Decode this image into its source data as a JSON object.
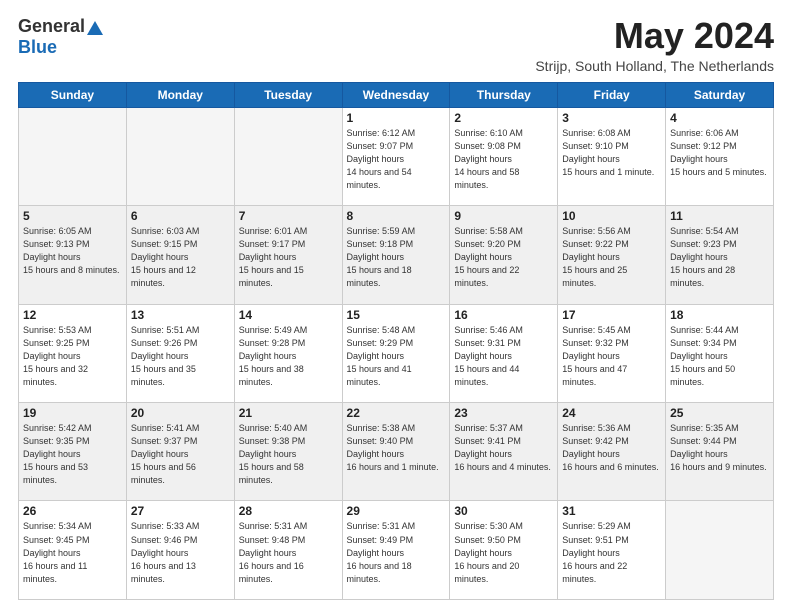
{
  "header": {
    "logo_general": "General",
    "logo_blue": "Blue",
    "month_title": "May 2024",
    "location": "Strijp, South Holland, The Netherlands"
  },
  "days_of_week": [
    "Sunday",
    "Monday",
    "Tuesday",
    "Wednesday",
    "Thursday",
    "Friday",
    "Saturday"
  ],
  "weeks": [
    [
      {
        "day": "",
        "empty": true
      },
      {
        "day": "",
        "empty": true
      },
      {
        "day": "",
        "empty": true
      },
      {
        "day": "1",
        "sunrise": "6:12 AM",
        "sunset": "9:07 PM",
        "daylight": "14 hours and 54 minutes."
      },
      {
        "day": "2",
        "sunrise": "6:10 AM",
        "sunset": "9:08 PM",
        "daylight": "14 hours and 58 minutes."
      },
      {
        "day": "3",
        "sunrise": "6:08 AM",
        "sunset": "9:10 PM",
        "daylight": "15 hours and 1 minute."
      },
      {
        "day": "4",
        "sunrise": "6:06 AM",
        "sunset": "9:12 PM",
        "daylight": "15 hours and 5 minutes."
      }
    ],
    [
      {
        "day": "5",
        "sunrise": "6:05 AM",
        "sunset": "9:13 PM",
        "daylight": "15 hours and 8 minutes."
      },
      {
        "day": "6",
        "sunrise": "6:03 AM",
        "sunset": "9:15 PM",
        "daylight": "15 hours and 12 minutes."
      },
      {
        "day": "7",
        "sunrise": "6:01 AM",
        "sunset": "9:17 PM",
        "daylight": "15 hours and 15 minutes."
      },
      {
        "day": "8",
        "sunrise": "5:59 AM",
        "sunset": "9:18 PM",
        "daylight": "15 hours and 18 minutes."
      },
      {
        "day": "9",
        "sunrise": "5:58 AM",
        "sunset": "9:20 PM",
        "daylight": "15 hours and 22 minutes."
      },
      {
        "day": "10",
        "sunrise": "5:56 AM",
        "sunset": "9:22 PM",
        "daylight": "15 hours and 25 minutes."
      },
      {
        "day": "11",
        "sunrise": "5:54 AM",
        "sunset": "9:23 PM",
        "daylight": "15 hours and 28 minutes."
      }
    ],
    [
      {
        "day": "12",
        "sunrise": "5:53 AM",
        "sunset": "9:25 PM",
        "daylight": "15 hours and 32 minutes."
      },
      {
        "day": "13",
        "sunrise": "5:51 AM",
        "sunset": "9:26 PM",
        "daylight": "15 hours and 35 minutes."
      },
      {
        "day": "14",
        "sunrise": "5:49 AM",
        "sunset": "9:28 PM",
        "daylight": "15 hours and 38 minutes."
      },
      {
        "day": "15",
        "sunrise": "5:48 AM",
        "sunset": "9:29 PM",
        "daylight": "15 hours and 41 minutes."
      },
      {
        "day": "16",
        "sunrise": "5:46 AM",
        "sunset": "9:31 PM",
        "daylight": "15 hours and 44 minutes."
      },
      {
        "day": "17",
        "sunrise": "5:45 AM",
        "sunset": "9:32 PM",
        "daylight": "15 hours and 47 minutes."
      },
      {
        "day": "18",
        "sunrise": "5:44 AM",
        "sunset": "9:34 PM",
        "daylight": "15 hours and 50 minutes."
      }
    ],
    [
      {
        "day": "19",
        "sunrise": "5:42 AM",
        "sunset": "9:35 PM",
        "daylight": "15 hours and 53 minutes."
      },
      {
        "day": "20",
        "sunrise": "5:41 AM",
        "sunset": "9:37 PM",
        "daylight": "15 hours and 56 minutes."
      },
      {
        "day": "21",
        "sunrise": "5:40 AM",
        "sunset": "9:38 PM",
        "daylight": "15 hours and 58 minutes."
      },
      {
        "day": "22",
        "sunrise": "5:38 AM",
        "sunset": "9:40 PM",
        "daylight": "16 hours and 1 minute."
      },
      {
        "day": "23",
        "sunrise": "5:37 AM",
        "sunset": "9:41 PM",
        "daylight": "16 hours and 4 minutes."
      },
      {
        "day": "24",
        "sunrise": "5:36 AM",
        "sunset": "9:42 PM",
        "daylight": "16 hours and 6 minutes."
      },
      {
        "day": "25",
        "sunrise": "5:35 AM",
        "sunset": "9:44 PM",
        "daylight": "16 hours and 9 minutes."
      }
    ],
    [
      {
        "day": "26",
        "sunrise": "5:34 AM",
        "sunset": "9:45 PM",
        "daylight": "16 hours and 11 minutes."
      },
      {
        "day": "27",
        "sunrise": "5:33 AM",
        "sunset": "9:46 PM",
        "daylight": "16 hours and 13 minutes."
      },
      {
        "day": "28",
        "sunrise": "5:31 AM",
        "sunset": "9:48 PM",
        "daylight": "16 hours and 16 minutes."
      },
      {
        "day": "29",
        "sunrise": "5:31 AM",
        "sunset": "9:49 PM",
        "daylight": "16 hours and 18 minutes."
      },
      {
        "day": "30",
        "sunrise": "5:30 AM",
        "sunset": "9:50 PM",
        "daylight": "16 hours and 20 minutes."
      },
      {
        "day": "31",
        "sunrise": "5:29 AM",
        "sunset": "9:51 PM",
        "daylight": "16 hours and 22 minutes."
      },
      {
        "day": "",
        "empty": true
      }
    ]
  ]
}
